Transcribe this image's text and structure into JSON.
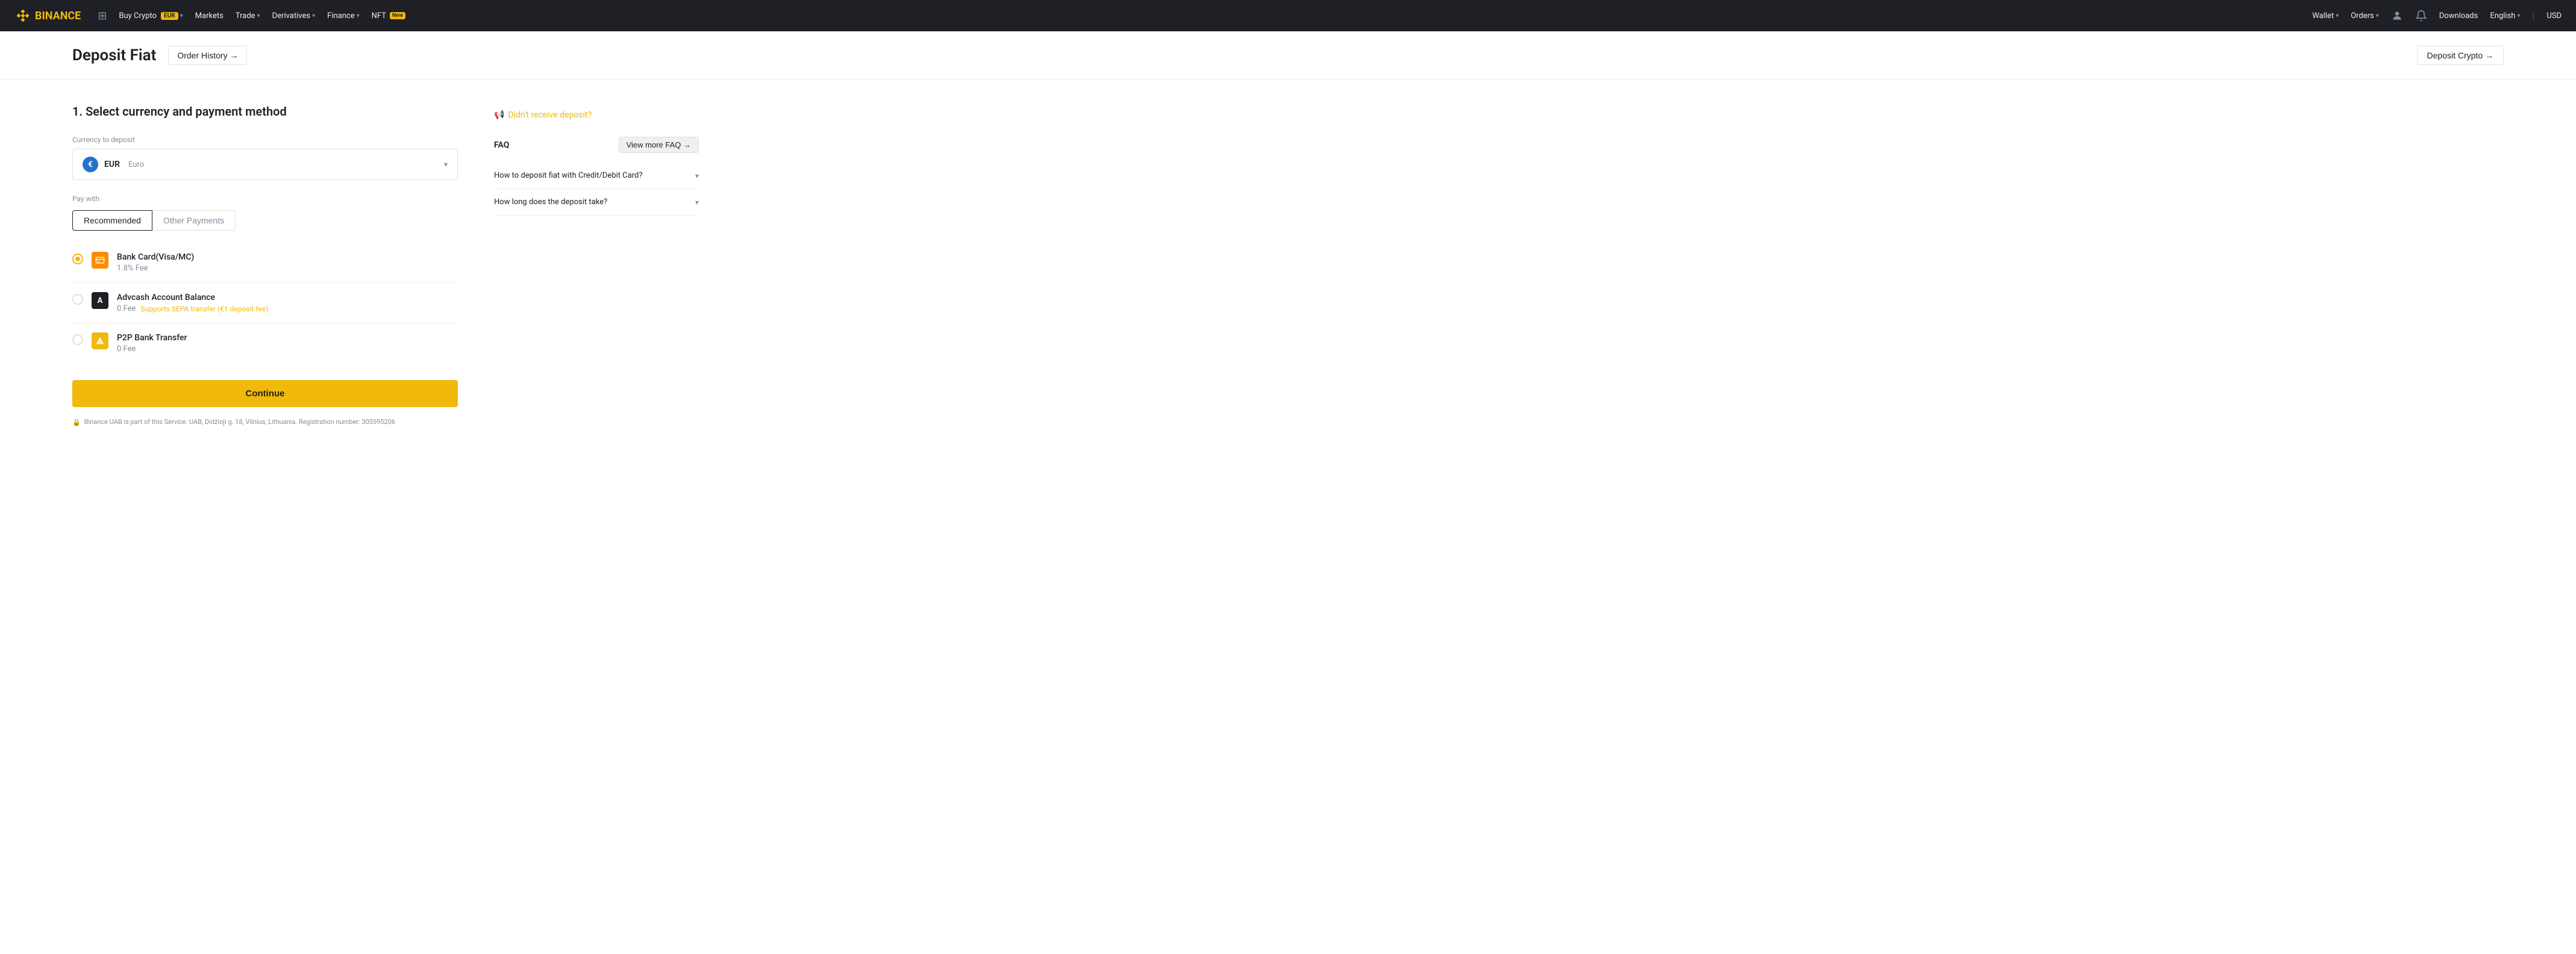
{
  "navbar": {
    "logo_text": "BINANCE",
    "nav_items": [
      {
        "id": "buy-crypto",
        "label": "Buy Crypto",
        "badge": "EUR",
        "has_arrow": true
      },
      {
        "id": "markets",
        "label": "Markets",
        "has_arrow": false
      },
      {
        "id": "trade",
        "label": "Trade",
        "has_arrow": true
      },
      {
        "id": "derivatives",
        "label": "Derivatives",
        "has_arrow": true
      },
      {
        "id": "finance",
        "label": "Finance",
        "has_arrow": true
      },
      {
        "id": "nft",
        "label": "NFT",
        "new_badge": "New",
        "has_arrow": false
      }
    ],
    "right_items": {
      "wallet": "Wallet",
      "orders": "Orders",
      "downloads": "Downloads",
      "language": "English",
      "currency": "USD"
    }
  },
  "page": {
    "title": "Deposit Fiat",
    "order_history_btn": "Order History →",
    "deposit_crypto_btn": "Deposit Crypto →"
  },
  "form": {
    "section_title": "1. Select currency and payment method",
    "currency_label": "Currency to deposit",
    "currency_code": "EUR",
    "currency_name": "Euro",
    "currency_initial": "€",
    "pay_with_label": "Pay with",
    "tabs": [
      {
        "id": "recommended",
        "label": "Recommended",
        "active": true
      },
      {
        "id": "other",
        "label": "Other Payments",
        "active": false
      }
    ],
    "payment_methods": [
      {
        "id": "bank-card",
        "name": "Bank Card(Visa/MC)",
        "fee": "1.8% Fee",
        "selected": true,
        "icon_text": "💳",
        "icon_class": "orange"
      },
      {
        "id": "advcash",
        "name": "Advcash Account Balance",
        "fee": "0 Fee",
        "sepa_note": "Supports SEPA transfer (€1 deposit fee)",
        "selected": false,
        "icon_text": "A",
        "icon_class": "dark"
      },
      {
        "id": "p2p",
        "name": "P2P Bank Transfer",
        "fee": "0 Fee",
        "selected": false,
        "icon_text": "⬡",
        "icon_class": "gold"
      }
    ],
    "continue_btn": "Continue"
  },
  "footer": {
    "note": "Binance UAB is part of this Service. UAB, Didžioji g. 18, Vilnius, Lithuania. Registration number: 305595206"
  },
  "sidebar": {
    "didnt_receive": "Didn't receive deposit?",
    "faq_title": "FAQ",
    "view_more_faq": "View more FAQ →",
    "faq_items": [
      {
        "question": "How to deposit fiat with Credit/Debit Card?"
      },
      {
        "question": "How long does the deposit take?"
      }
    ]
  }
}
